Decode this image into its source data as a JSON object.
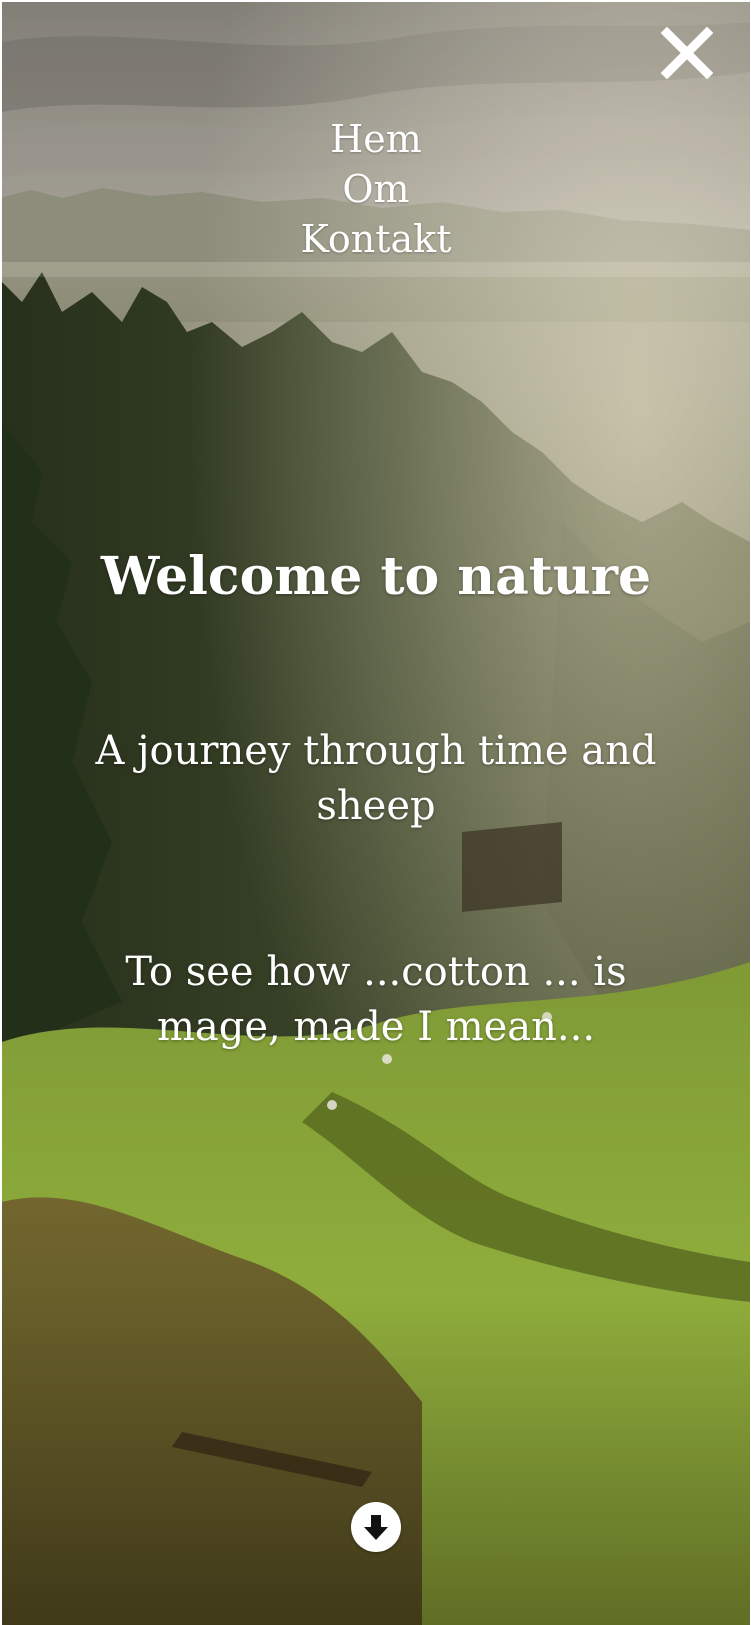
{
  "nav": {
    "items": [
      {
        "label": "Hem"
      },
      {
        "label": "Om"
      },
      {
        "label": "Kontakt"
      }
    ],
    "close_icon": "close-icon"
  },
  "hero": {
    "headline": "Welcome to nature",
    "tagline": "A journey through time and sheep",
    "subtext": "To see how ...cotton ... is mage, made I mean...",
    "scroll_icon": "arrow-down-circle-icon"
  },
  "colors": {
    "text": "#ffffff",
    "sky": "#c8c3b4",
    "forest_dark": "#2f3a22",
    "meadow": "#8ba63a"
  }
}
